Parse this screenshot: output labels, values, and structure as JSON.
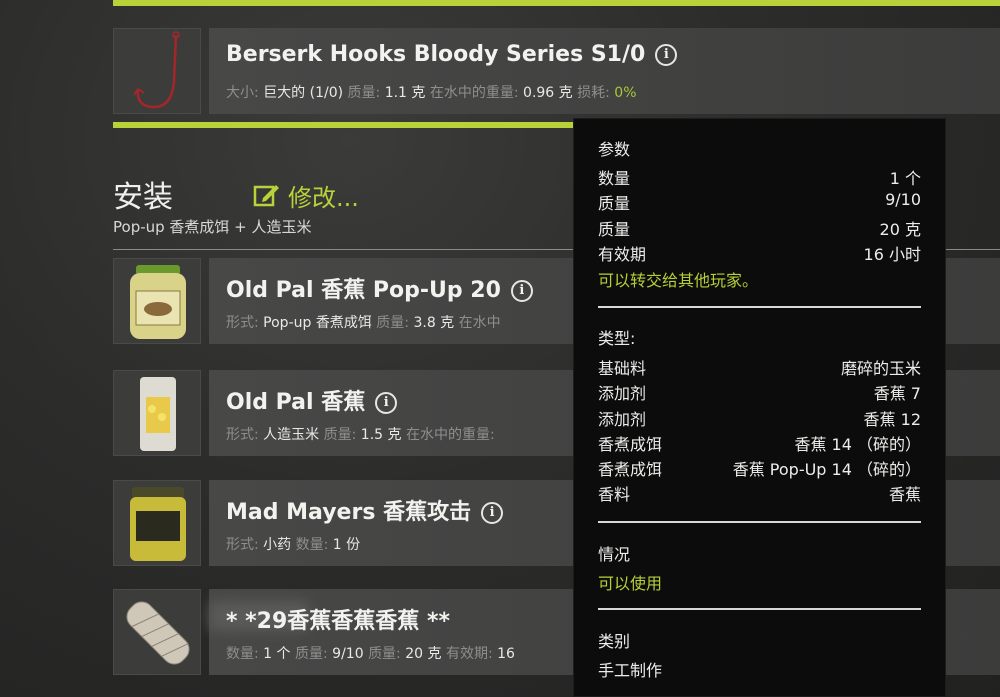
{
  "top_item": {
    "title": "Berserk Hooks Bloody Series S1/0",
    "meta": [
      {
        "label": "大小:",
        "value": "巨大的 (1/0)"
      },
      {
        "label": "质量:",
        "value": "1.1 克"
      },
      {
        "label": "在水中的重量:",
        "value": "0.96 克"
      },
      {
        "label": "损耗:",
        "value": "0%",
        "accent": true
      }
    ]
  },
  "section": {
    "title": "安装",
    "edit_label": "修改...",
    "subtitle": "Pop-up 香煮成饵 + 人造玉米"
  },
  "items": [
    {
      "title": "Old Pal 香蕉 Pop-Up 20",
      "meta": [
        {
          "label": "形式:",
          "value": "Pop-up 香煮成饵"
        },
        {
          "label": "质量:",
          "value": "3.8 克"
        },
        {
          "label": "在水中",
          "value": ""
        }
      ]
    },
    {
      "title": "Old Pal 香蕉",
      "meta": [
        {
          "label": "形式:",
          "value": "人造玉米"
        },
        {
          "label": "质量:",
          "value": "1.5 克"
        },
        {
          "label": "在水中的重量:",
          "value": ""
        }
      ]
    },
    {
      "title": "Mad Mayers 香蕉攻击",
      "meta": [
        {
          "label": "形式:",
          "value": "小药"
        },
        {
          "label": "数量:",
          "value": "1 份"
        }
      ]
    },
    {
      "title": "* *29香蕉香蕉香蕉 **",
      "meta": [
        {
          "label": "数量:",
          "value": "1 个"
        },
        {
          "label": "质量:",
          "value": "9/10"
        },
        {
          "label": "质量:",
          "value": "20 克"
        },
        {
          "label": "有效期:",
          "value": "16"
        }
      ]
    }
  ],
  "tooltip": {
    "params_title": "参数",
    "params": [
      {
        "k": "数量",
        "v": "1 个"
      },
      {
        "k": "质量",
        "v": "9/10"
      },
      {
        "k": "质量",
        "v": "20 克"
      },
      {
        "k": "有效期",
        "v": "16 小时"
      }
    ],
    "transfer_note": "可以转交给其他玩家。",
    "type_title": "类型:",
    "types": [
      {
        "k": "基础料",
        "v": "磨碎的玉米"
      },
      {
        "k": "添加剂",
        "v": "香蕉 7"
      },
      {
        "k": "添加剂",
        "v": "香蕉 12"
      },
      {
        "k": "香煮成饵",
        "v": "香蕉 14 （碎的）"
      },
      {
        "k": "香煮成饵",
        "v": "香蕉 Pop-Up 14 （碎的）"
      },
      {
        "k": "香料",
        "v": "香蕉"
      }
    ],
    "status_title": "情况",
    "status_value": "可以使用",
    "category_title": "类别",
    "category_value": "手工制作"
  },
  "colors": {
    "accent": "#b9d23a",
    "tooltip_bg": "#0c0c0c"
  }
}
